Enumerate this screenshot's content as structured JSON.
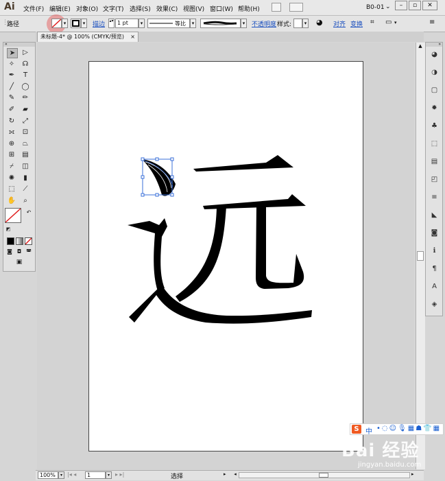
{
  "app": {
    "logo": "Ai",
    "doc_name": "B0-01"
  },
  "menu": [
    "文件(F)",
    "编辑(E)",
    "对象(O)",
    "文字(T)",
    "选择(S)",
    "效果(C)",
    "视图(V)",
    "窗口(W)",
    "帮助(H)"
  ],
  "window_controls": {
    "minimize": "–",
    "restore": "▫",
    "close": "✕"
  },
  "control_bar": {
    "object_type": "路径",
    "stroke_label": "描边",
    "stroke_weight": "1 pt",
    "profile_label": "等比",
    "opacity_label": "不透明度",
    "style_label": "样式",
    "align_label": "对齐",
    "transform_label": "变换"
  },
  "tab": {
    "title": "未标题-4* @ 100% (CMYK/预览)",
    "close": "×"
  },
  "status": {
    "zoom": "100%",
    "artboard_num": "1",
    "tool": "选择"
  },
  "artwork": {
    "character": "远"
  },
  "ime": {
    "label": "中"
  },
  "watermark": {
    "main": "Bai 经验",
    "sub": "jingyan.baidu.com"
  },
  "colors": {
    "fill_none_red": "#e02020",
    "accent_link": "#1a4fbf",
    "selection_blue": "#3a6fd8"
  },
  "tool_icons": [
    "selection-tool",
    "direct-selection-tool",
    "magic-wand-tool",
    "lasso-tool",
    "pen-tool",
    "type-tool",
    "line-tool",
    "ellipse-tool",
    "paintbrush-tool",
    "pencil-tool",
    "blob-brush-tool",
    "eraser-tool",
    "rotate-tool",
    "scale-tool",
    "width-tool",
    "free-transform-tool",
    "shape-builder-tool",
    "perspective-tool",
    "mesh-tool",
    "gradient-tool",
    "eyedropper-tool",
    "blend-tool",
    "symbol-sprayer-tool",
    "graph-tool",
    "artboard-tool",
    "slice-tool",
    "hand-tool",
    "zoom-tool"
  ]
}
